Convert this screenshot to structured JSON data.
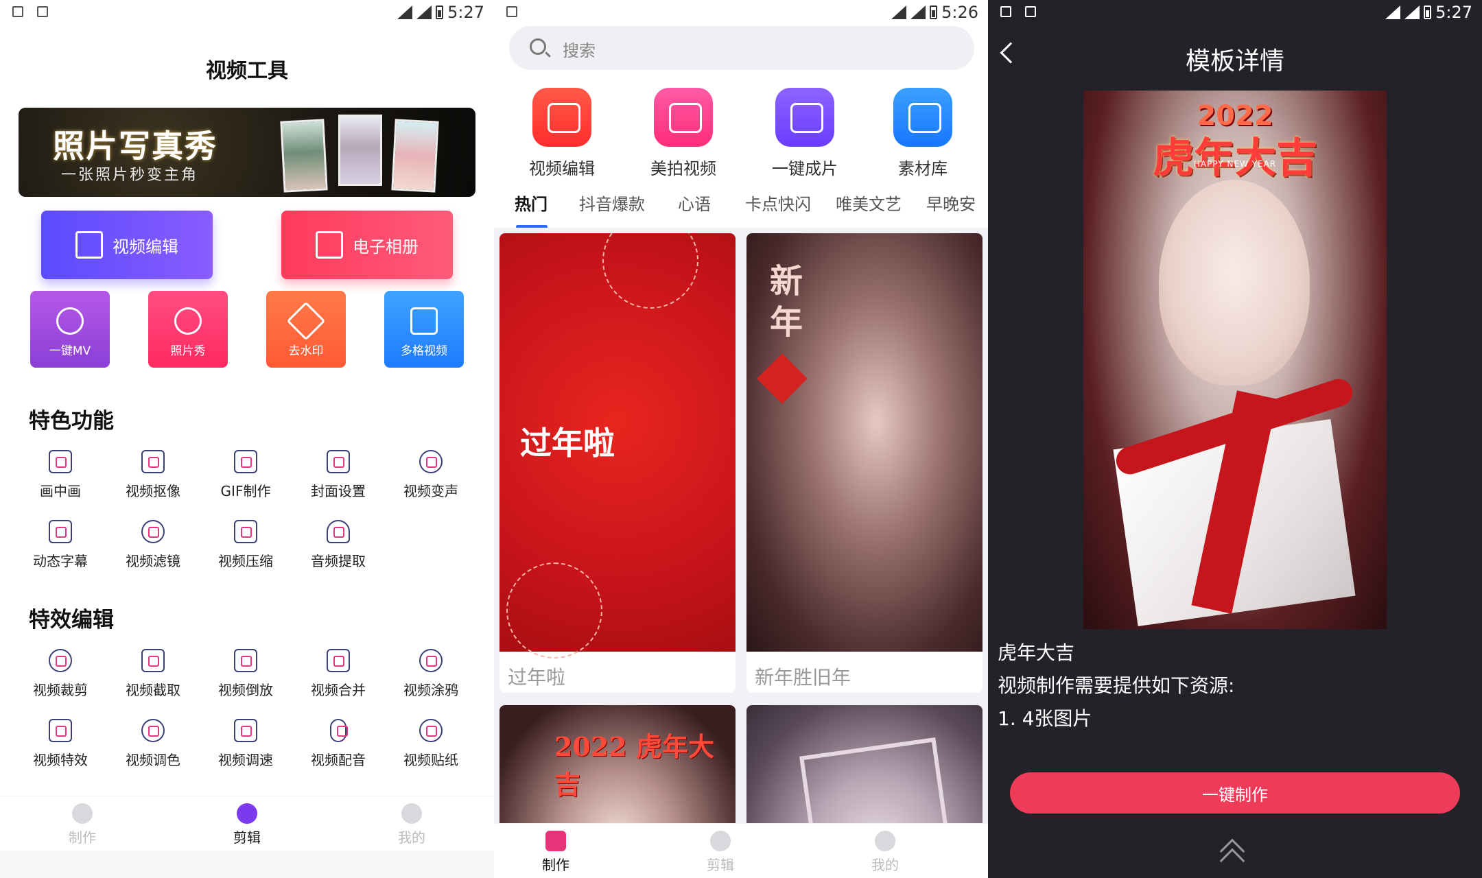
{
  "status": {
    "time1": "5:27",
    "time2": "5:26",
    "time3": "5:27"
  },
  "screen1": {
    "title": "视频工具",
    "banner": {
      "title": "照片写真秀",
      "subtitle": "一张照片秒变主角"
    },
    "big_buttons": [
      {
        "label": "视频编辑",
        "color": "#6a46ff"
      },
      {
        "label": "电子相册",
        "color": "#ff3b5c"
      }
    ],
    "tiles": [
      {
        "label": "一键MV",
        "color": "#a14cdf"
      },
      {
        "label": "照片秀",
        "color": "#ff3a6e"
      },
      {
        "label": "去水印",
        "color": "#ff6a3d"
      },
      {
        "label": "多格视频",
        "color": "#2b8cff"
      }
    ],
    "section1": "特色功能",
    "features1": [
      "画中画",
      "视频抠像",
      "GIF制作",
      "封面设置",
      "视频变声",
      "动态字幕",
      "视频滤镜",
      "视频压缩",
      "音频提取"
    ],
    "section2": "特效编辑",
    "features2": [
      "视频裁剪",
      "视频截取",
      "视频倒放",
      "视频合并",
      "视频涂鸦",
      "视频特效",
      "视频调色",
      "视频调速",
      "视频配音",
      "视频贴纸"
    ],
    "tabbar": [
      "制作",
      "剪辑",
      "我的"
    ]
  },
  "screen2": {
    "search_placeholder": "搜索",
    "quick": [
      {
        "label": "视频编辑",
        "color": "#ff3b30"
      },
      {
        "label": "美拍视频",
        "color": "#ff3d8a"
      },
      {
        "label": "一键成片",
        "color": "#7b4dff"
      },
      {
        "label": "素材库",
        "color": "#1e88ff"
      }
    ],
    "tabs": [
      "热门",
      "抖音爆款",
      "心语",
      "卡点快闪",
      "唯美文艺",
      "早晚安"
    ],
    "cards": [
      {
        "title": "过年啦",
        "overlay": "过年啦"
      },
      {
        "title": "新年胜旧年",
        "overlay": "新年"
      },
      {
        "title": "",
        "overlay": "2022 虎年大吉"
      },
      {
        "title": "",
        "overlay": ""
      }
    ],
    "tabbar": [
      "制作",
      "剪辑",
      "我的"
    ]
  },
  "screen3": {
    "title": "模板详情",
    "poster": {
      "year": "2022",
      "title": "虎年大吉",
      "eng": "HAPPY NEW YEAR"
    },
    "name": "虎年大吉",
    "desc": "视频制作需要提供如下资源:",
    "req": "1. 4张图片",
    "button": "一键制作"
  }
}
